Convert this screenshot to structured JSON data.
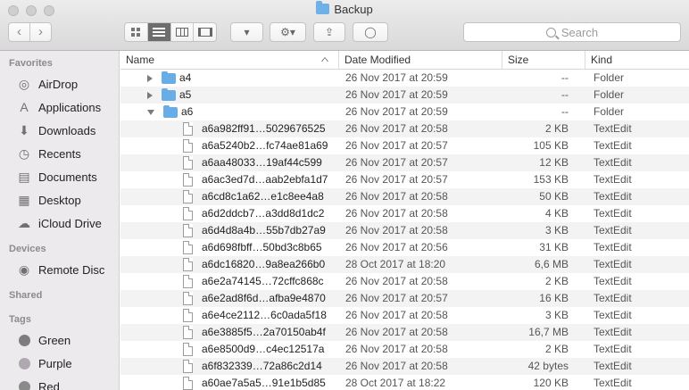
{
  "window": {
    "title": "Backup"
  },
  "toolbar": {
    "search_placeholder": "Search",
    "back_glyph": "‹",
    "forward_glyph": "›",
    "arrange_glyph": "▾",
    "action_glyph": "⚙▾",
    "share_glyph": "⇪",
    "tags_glyph": "◯"
  },
  "sidebar": {
    "favorites_label": "Favorites",
    "favorites": [
      {
        "label": "AirDrop",
        "icon": "airdrop-icon"
      },
      {
        "label": "Applications",
        "icon": "applications-icon"
      },
      {
        "label": "Downloads",
        "icon": "downloads-icon"
      },
      {
        "label": "Recents",
        "icon": "recents-icon"
      },
      {
        "label": "Documents",
        "icon": "documents-icon"
      },
      {
        "label": "Desktop",
        "icon": "desktop-icon"
      },
      {
        "label": "iCloud Drive",
        "icon": "icloud-icon"
      }
    ],
    "devices_label": "Devices",
    "devices": [
      {
        "label": "Remote Disc",
        "icon": "disc-icon"
      }
    ],
    "shared_label": "Shared",
    "tags_label": "Tags",
    "tags": [
      {
        "label": "Green",
        "color": "#7d7d7d"
      },
      {
        "label": "Purple",
        "color": "#b0a8b0"
      },
      {
        "label": "Red",
        "color": "#8a8a8a"
      }
    ]
  },
  "columns": {
    "name": "Name",
    "date": "Date Modified",
    "size": "Size",
    "kind": "Kind"
  },
  "rows": [
    {
      "type": "folder",
      "expanded": false,
      "name": "a4",
      "date": "26 Nov 2017 at 20:59",
      "size": "--",
      "kind": "Folder"
    },
    {
      "type": "folder",
      "expanded": false,
      "name": "a5",
      "date": "26 Nov 2017 at 20:59",
      "size": "--",
      "kind": "Folder"
    },
    {
      "type": "folder",
      "expanded": true,
      "name": "a6",
      "date": "26 Nov 2017 at 20:59",
      "size": "--",
      "kind": "Folder"
    },
    {
      "type": "file",
      "name": "a6a982ff91…5029676525",
      "date": "26 Nov 2017 at 20:58",
      "size": "2 KB",
      "kind": "TextEdit"
    },
    {
      "type": "file",
      "name": "a6a5240b2…fc74ae81a69",
      "date": "26 Nov 2017 at 20:57",
      "size": "105 KB",
      "kind": "TextEdit"
    },
    {
      "type": "file",
      "name": "a6aa48033…19af44c599",
      "date": "26 Nov 2017 at 20:57",
      "size": "12 KB",
      "kind": "TextEdit"
    },
    {
      "type": "file",
      "name": "a6ac3ed7d…aab2ebfa1d7",
      "date": "26 Nov 2017 at 20:57",
      "size": "153 KB",
      "kind": "TextEdit"
    },
    {
      "type": "file",
      "name": "a6cd8c1a62…e1c8ee4a8",
      "date": "26 Nov 2017 at 20:58",
      "size": "50 KB",
      "kind": "TextEdit"
    },
    {
      "type": "file",
      "name": "a6d2ddcb7…a3dd8d1dc2",
      "date": "26 Nov 2017 at 20:58",
      "size": "4 KB",
      "kind": "TextEdit"
    },
    {
      "type": "file",
      "name": "a6d4d8a4b…55b7db27a9",
      "date": "26 Nov 2017 at 20:58",
      "size": "3 KB",
      "kind": "TextEdit"
    },
    {
      "type": "file",
      "name": "a6d698fbff…50bd3c8b65",
      "date": "26 Nov 2017 at 20:56",
      "size": "31 KB",
      "kind": "TextEdit"
    },
    {
      "type": "file",
      "name": "a6dc16820…9a8ea266b0",
      "date": "28 Oct 2017 at 18:20",
      "size": "6,6 MB",
      "kind": "TextEdit"
    },
    {
      "type": "file",
      "name": "a6e2a74145…72cffc868c",
      "date": "26 Nov 2017 at 20:58",
      "size": "2 KB",
      "kind": "TextEdit"
    },
    {
      "type": "file",
      "name": "a6e2ad8f6d…afba9e4870",
      "date": "26 Nov 2017 at 20:57",
      "size": "16 KB",
      "kind": "TextEdit"
    },
    {
      "type": "file",
      "name": "a6e4ce2112…6c0ada5f18",
      "date": "26 Nov 2017 at 20:58",
      "size": "3 KB",
      "kind": "TextEdit"
    },
    {
      "type": "file",
      "name": "a6e3885f5…2a70150ab4f",
      "date": "26 Nov 2017 at 20:58",
      "size": "16,7 MB",
      "kind": "TextEdit"
    },
    {
      "type": "file",
      "name": "a6e8500d9…c4ec12517a",
      "date": "26 Nov 2017 at 20:58",
      "size": "2 KB",
      "kind": "TextEdit"
    },
    {
      "type": "file",
      "name": "a6f832339…72a86c2d14",
      "date": "26 Nov 2017 at 20:58",
      "size": "42 bytes",
      "kind": "TextEdit"
    },
    {
      "type": "file",
      "name": "a60ae7a5a5…91e1b5d85",
      "date": "28 Oct 2017 at 18:22",
      "size": "120 KB",
      "kind": "TextEdit"
    }
  ]
}
